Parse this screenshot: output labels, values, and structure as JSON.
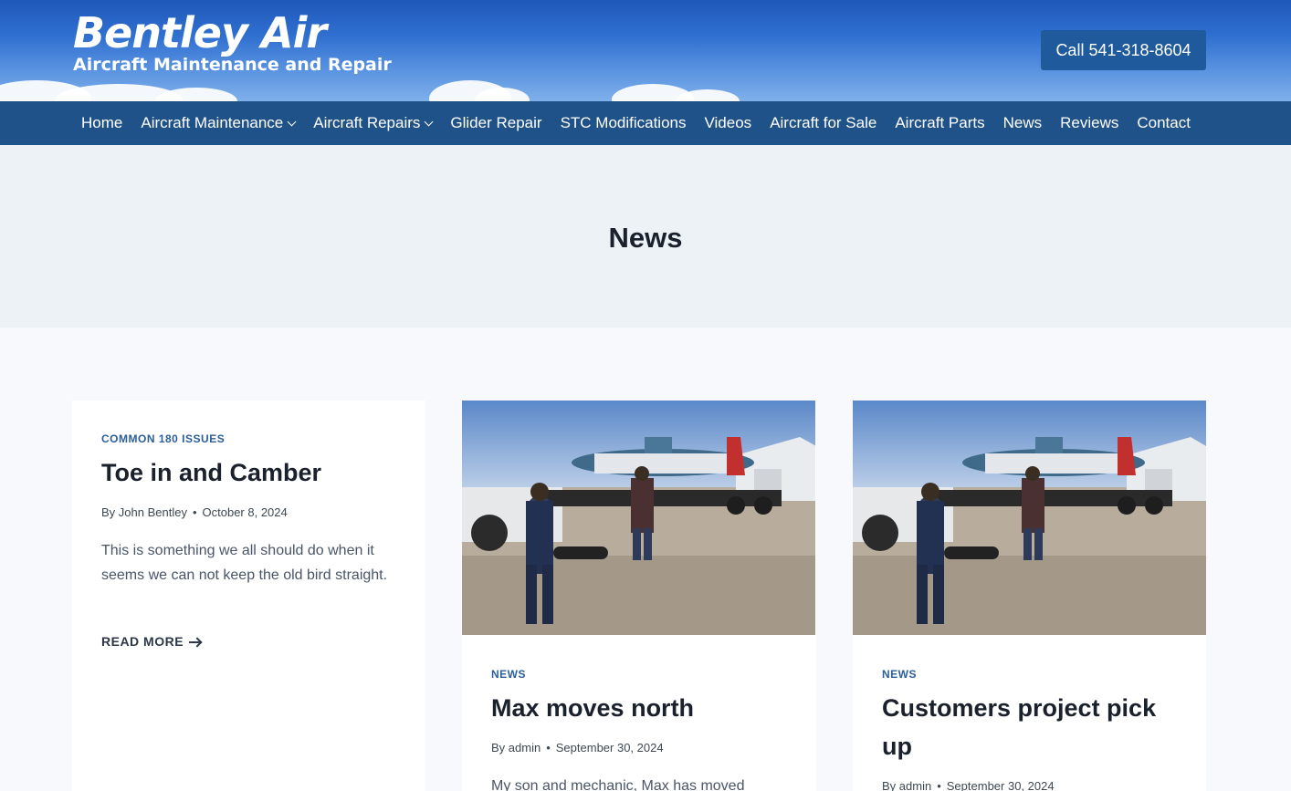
{
  "header": {
    "logo_title": "Bentley Air",
    "logo_subtitle": "Aircraft Maintenance and Repair",
    "call_button": "Call 541-318-8604"
  },
  "nav": {
    "items": [
      {
        "label": "Home",
        "has_dropdown": false
      },
      {
        "label": "Aircraft Maintenance",
        "has_dropdown": true
      },
      {
        "label": "Aircraft Repairs",
        "has_dropdown": true
      },
      {
        "label": "Glider Repair",
        "has_dropdown": false
      },
      {
        "label": "STC Modifications",
        "has_dropdown": false
      },
      {
        "label": "Videos",
        "has_dropdown": false
      },
      {
        "label": "Aircraft for Sale",
        "has_dropdown": false
      },
      {
        "label": "Aircraft Parts",
        "has_dropdown": false
      },
      {
        "label": "News",
        "has_dropdown": false
      },
      {
        "label": "Reviews",
        "has_dropdown": false
      },
      {
        "label": "Contact",
        "has_dropdown": false
      }
    ]
  },
  "page": {
    "title": "News"
  },
  "posts": [
    {
      "category": "COMMON 180 ISSUES",
      "title": "Toe in and Camber",
      "author": "By John Bentley",
      "date": "October 8, 2024",
      "excerpt": "This is something we all should do when it seems we can not keep the old bird straight.",
      "read_more": "READ MORE"
    },
    {
      "category": "NEWS",
      "title": "Max moves north",
      "author": "By admin",
      "date": "September 30, 2024",
      "excerpt": "My son and mechanic, Max has moved"
    },
    {
      "category": "NEWS",
      "title": "Customers project pick up",
      "author": "By admin",
      "date": "September 30, 2024"
    }
  ],
  "colors": {
    "nav_bg": "#1f5288",
    "call_button_bg": "#1f5a9c",
    "category_text": "#2a5f98",
    "title_band_bg": "#edf2f7"
  }
}
